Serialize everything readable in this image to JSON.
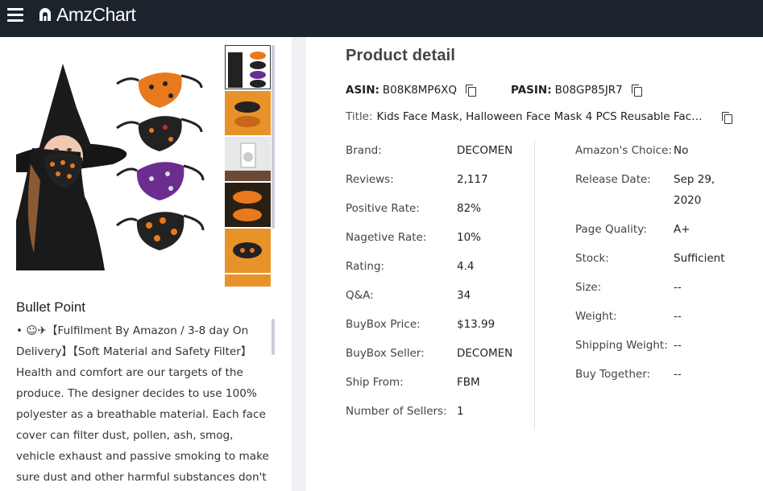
{
  "app": {
    "logo_text": "AmzChart"
  },
  "bullet": {
    "title": "Bullet Point",
    "text": "• ☺✈【Fulfilment By Amazon / 3-8 day On Delivery】【Soft Material and Safety Filter】 Health and comfort are our targets of the produce. The designer decides to use 100% polyester as a breathable material. Each face cover can filter dust, pollen, ash, smog, vehicle exhaust and passive smoking to make sure dust and other harmful substances don't get into the"
  },
  "product": {
    "heading": "Product detail",
    "asin_label": "ASIN:",
    "asin": "B08K8MP6XQ",
    "pasin_label": "PASIN:",
    "pasin": "B08GP85JR7",
    "title_label": "Title:",
    "title": "Kids Face Mask, Halloween Face Mask 4 PCS Reusable Face ...",
    "left": [
      {
        "k": "Brand:",
        "v": "DECOMEN"
      },
      {
        "k": "Reviews:",
        "v": "2,117"
      },
      {
        "k": "Positive Rate:",
        "v": "82%"
      },
      {
        "k": "Nagetive Rate:",
        "v": "10%"
      },
      {
        "k": "Rating:",
        "v": "4.4"
      },
      {
        "k": "Q&A:",
        "v": "34"
      },
      {
        "k": "BuyBox Price:",
        "v": "$13.99"
      },
      {
        "k": "BuyBox Seller:",
        "v": "DECOMEN"
      },
      {
        "k": "Ship From:",
        "v": "FBM"
      },
      {
        "k": "Number of Sellers:",
        "v": "1"
      }
    ],
    "right": [
      {
        "k": "Amazon's Choice:",
        "v": "No"
      },
      {
        "k": "Release Date:",
        "v": "Sep 29, 2020"
      },
      {
        "k": "Page Quality:",
        "v": "A+"
      },
      {
        "k": "Stock:",
        "v": "Sufficient"
      },
      {
        "k": "Size:",
        "v": "--"
      },
      {
        "k": "Weight:",
        "v": "--"
      },
      {
        "k": "Shipping Weight:",
        "v": "--"
      },
      {
        "k": "Buy Together:",
        "v": "--"
      }
    ]
  },
  "colors": {
    "topbar": "#1d232c",
    "divider": "#eef0f3",
    "mask_orange": "#e8791e",
    "mask_black": "#222222",
    "mask_purple": "#6b2d8f"
  }
}
